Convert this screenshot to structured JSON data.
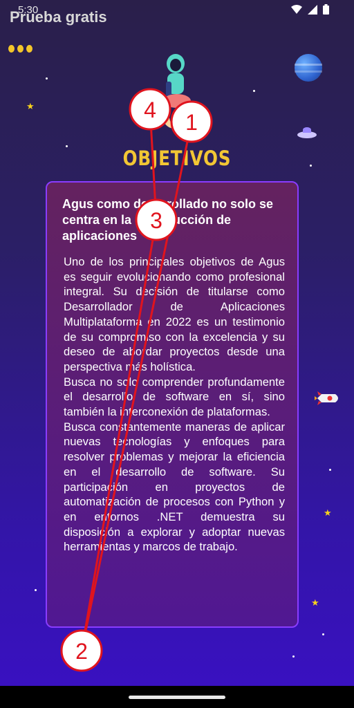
{
  "status_bar": {
    "time": "5:30"
  },
  "app": {
    "banner_title": "Prueba gratis"
  },
  "page": {
    "section_title": "OBJETIVOS"
  },
  "card": {
    "heading": "Agus como desarrollado no solo se centra en la construcción de aplicaciones",
    "paragraphs": [
      "Uno de los principales objetivos de Agus es seguir evolucionando como profesional integral. Su decisión de titularse como Desarrollador de Aplicaciones Multiplataforma en 2022 es un testimonio de su compromiso con la excelencia y su deseo de abordar proyectos desde una perspectiva más holística.",
      "Busca no solo comprender profundamente el desarrollo de software en sí, sino también la interconexión de plataformas.",
      "Busca constantemente maneras de aplicar nuevas tecnologías y enfoques para resolver problemas y mejorar la eficiencia en el desarrollo de software. Su participación en proyectos de automatización de procesos con Python y en entornos .NET demuestra su disposición a explorar y adoptar nuevas herramientas y marcos de trabajo."
    ]
  },
  "annotations": {
    "marker_1": "1",
    "marker_2": "2",
    "marker_3": "3",
    "marker_4": "4"
  },
  "colors": {
    "accent": "#8a3cff",
    "title": "#f2c634",
    "marker": "#e0141e"
  }
}
